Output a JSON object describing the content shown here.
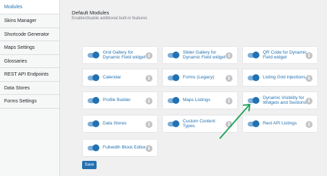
{
  "sidebar": {
    "items": [
      {
        "label": "Modules",
        "active": true
      },
      {
        "label": "Skins Manager"
      },
      {
        "label": "Shortcode Generator"
      },
      {
        "label": "Maps Settings"
      },
      {
        "label": "Glossaries"
      },
      {
        "label": "REST API Endpoints"
      },
      {
        "label": "Data Stores"
      },
      {
        "label": "Forms Settings"
      }
    ]
  },
  "header": {
    "title": "Default Modules",
    "subtitle": "Enable/disable additional built-in features"
  },
  "modules": [
    {
      "label": "Grid Gallery for Dynamic Field widget",
      "enabled": true
    },
    {
      "label": "Slider Gallery for Dynamic Field widget",
      "enabled": true
    },
    {
      "label": "QR Code for Dynamic Field widget",
      "enabled": true
    },
    {
      "label": "Calendar",
      "enabled": true
    },
    {
      "label": "Forms (Legacy)",
      "enabled": true
    },
    {
      "label": "Listing Grid injections",
      "enabled": true
    },
    {
      "label": "Profile Builder",
      "enabled": true
    },
    {
      "label": "Maps Listings",
      "enabled": true
    },
    {
      "label": "Dynamic Visibility for Widgets and Sections",
      "enabled": true
    },
    {
      "label": "Data Stores",
      "enabled": true
    },
    {
      "label": "Custom Content Types",
      "enabled": true
    },
    {
      "label": "Rest API Listings",
      "enabled": true
    },
    {
      "label": "Fullwidth Block Editor",
      "enabled": true
    }
  ],
  "info_icon": "i",
  "save_label": "Save",
  "colors": {
    "accent": "#2271b1",
    "toggle_track": "#7eb0dd",
    "arrow": "#1fa35a",
    "info": "#c3c4c7"
  },
  "icons": {
    "info": "info-icon",
    "toggle": "toggle-switch",
    "arrow": "annotation-arrow-icon"
  }
}
